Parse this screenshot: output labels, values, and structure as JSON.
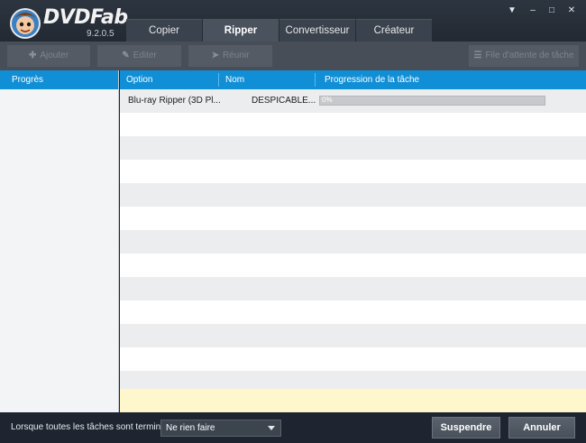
{
  "app": {
    "brand": "DVDFab",
    "version": "9.2.0.5"
  },
  "window_controls": {
    "menu": "▼",
    "minimize": "–",
    "maximize": "□",
    "close": "✕"
  },
  "tabs": [
    {
      "label": "Copier"
    },
    {
      "label": "Ripper"
    },
    {
      "label": "Convertisseur"
    },
    {
      "label": "Créateur"
    }
  ],
  "toolbar": {
    "add_label": "Ajouter",
    "edit_label": "Editer",
    "merge_label": "Réunir",
    "queue_label": "File d'attente de tâche"
  },
  "sidebar": {
    "header": "Progrès"
  },
  "table": {
    "columns": [
      "Option",
      "Nom",
      "Progression de la tâche"
    ],
    "rows": [
      {
        "option": "Blu-ray Ripper (3D Pl...",
        "name": "DESPICABLE...",
        "progress_text": "0%",
        "progress_value": 0
      }
    ]
  },
  "status": {
    "when_done_label": "Lorsque toutes les tâches sont terminées:",
    "when_done_value": "Ne rien faire",
    "suspend_label": "Suspendre",
    "cancel_label": "Annuler"
  }
}
